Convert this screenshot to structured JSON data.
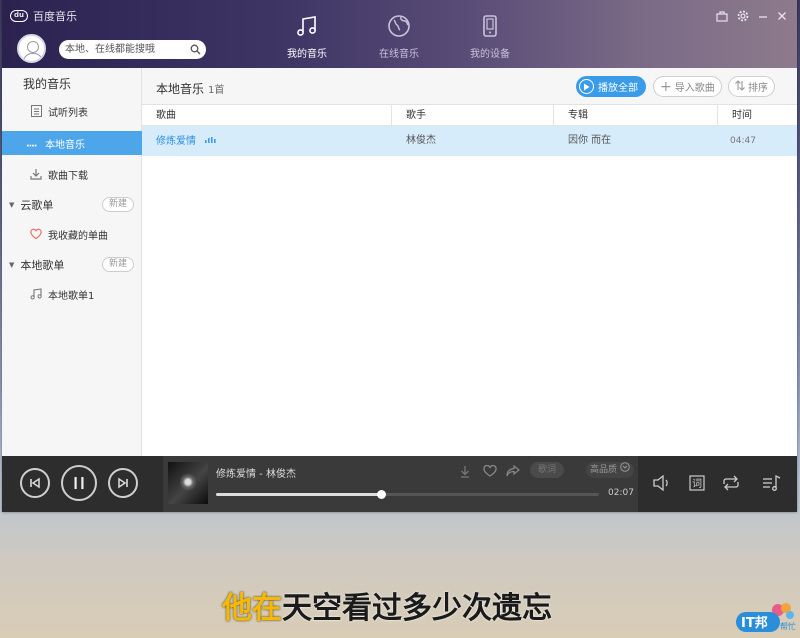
{
  "app": {
    "title": "百度音乐"
  },
  "header": {
    "search_placeholder": "本地、在线都能搜哦",
    "nav": [
      {
        "label": "我的音乐",
        "active": true,
        "icon": "music-note-icon"
      },
      {
        "label": "在线音乐",
        "active": false,
        "icon": "globe-icon"
      },
      {
        "label": "我的设备",
        "active": false,
        "icon": "phone-icon"
      }
    ]
  },
  "sidebar": {
    "my_music_title": "我的音乐",
    "items": [
      {
        "label": "试听列表",
        "icon": "list-icon",
        "active": false
      },
      {
        "label": "本地音乐",
        "icon": "equalizer-icon",
        "active": true
      },
      {
        "label": "歌曲下载",
        "icon": "download-icon",
        "active": false
      }
    ],
    "cloud_playlist": {
      "label": "云歌单",
      "new_label": "新建",
      "items": [
        {
          "label": "我收藏的单曲",
          "icon": "heart-icon"
        }
      ]
    },
    "local_playlist": {
      "label": "本地歌单",
      "new_label": "新建",
      "items": [
        {
          "label": "本地歌单1",
          "icon": "music-note-icon"
        }
      ]
    }
  },
  "main": {
    "title": "本地音乐",
    "count": "1首",
    "play_all": "播放全部",
    "import": "导入歌曲",
    "sort": "排序",
    "columns": [
      "歌曲",
      "歌手",
      "专辑",
      "时间"
    ],
    "rows": [
      {
        "song": "修炼爱情",
        "artist": "林俊杰",
        "album": "因你 而在",
        "time": "04:47"
      }
    ]
  },
  "player": {
    "now_playing": "修炼爱情 - 林俊杰",
    "progress": 0.43,
    "elapsed": "02:07",
    "quality": "高品质",
    "lyrics_label": "歌词"
  },
  "subtitle": {
    "highlight": "他在",
    "rest": "天空看过多少次遗忘"
  },
  "colors": {
    "accent": "#3a9be8",
    "selected_row": "#d6ecfb",
    "subtitle_highlight": "#f6b800"
  },
  "watermark": {
    "text_main": "IT邦",
    "text_sub": "帮忙"
  }
}
